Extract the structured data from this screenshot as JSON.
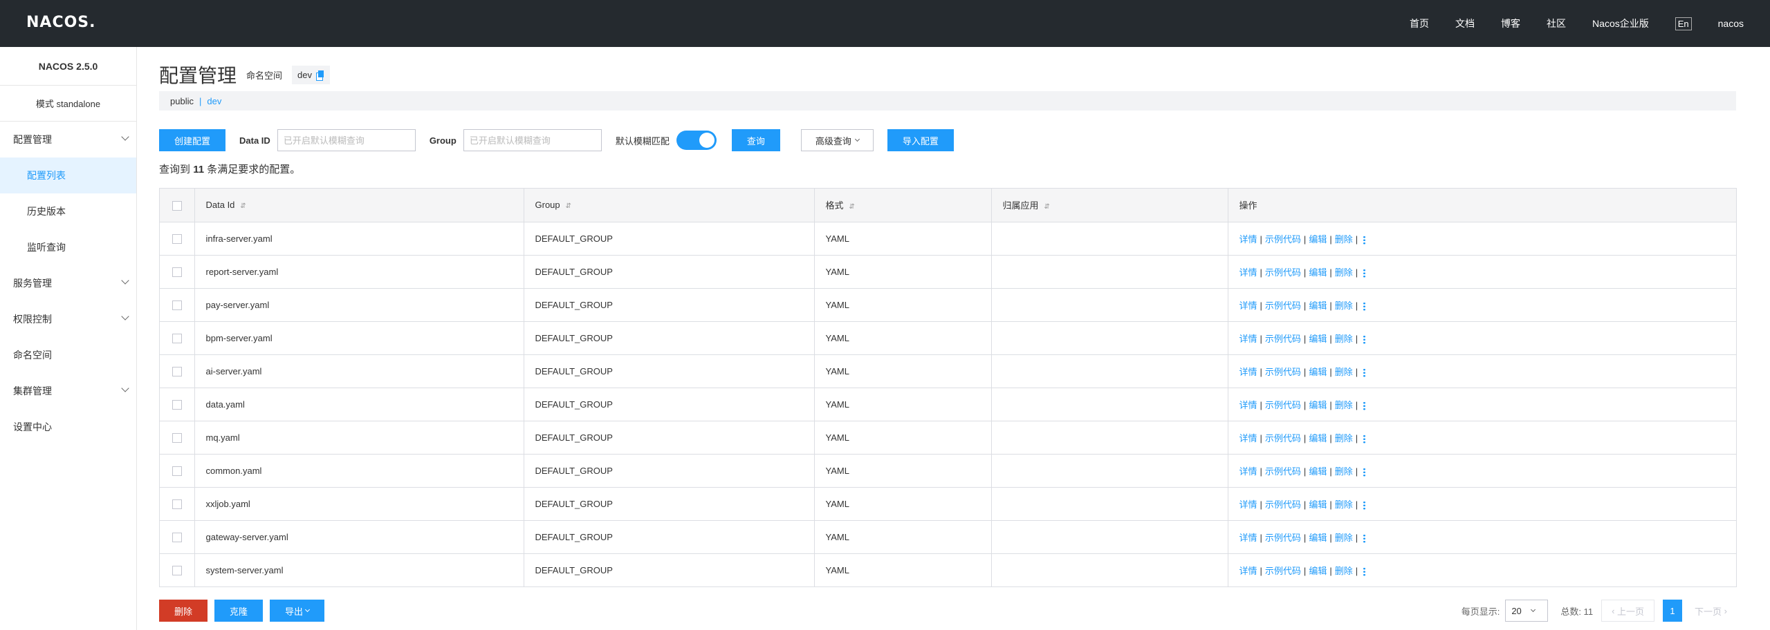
{
  "topbar": {
    "logo": "NACOS.",
    "nav": [
      "首页",
      "文档",
      "博客",
      "社区",
      "Nacos企业版"
    ],
    "lang": "En",
    "user": "nacos"
  },
  "sidebar": {
    "version": "NACOS 2.5.0",
    "mode": "模式 standalone",
    "items": [
      {
        "label": "配置管理",
        "expandable": true
      },
      {
        "label": "配置列表",
        "sub": true,
        "active": true
      },
      {
        "label": "历史版本",
        "sub": true
      },
      {
        "label": "监听查询",
        "sub": true
      },
      {
        "label": "服务管理",
        "expandable": true
      },
      {
        "label": "权限控制",
        "expandable": true
      },
      {
        "label": "命名空间"
      },
      {
        "label": "集群管理",
        "expandable": true
      },
      {
        "label": "设置中心"
      }
    ]
  },
  "header": {
    "title": "配置管理",
    "ns_label": "命名空间",
    "ns_value": "dev"
  },
  "ns_bar": {
    "public": "public",
    "sep": "|",
    "dev": "dev"
  },
  "toolbar": {
    "create": "创建配置",
    "dataid_label": "Data ID",
    "dataid_placeholder": "已开启默认模糊查询",
    "group_label": "Group",
    "group_placeholder": "已开启默认模糊查询",
    "fuzzy_label": "默认模糊匹配",
    "fuzzy_on": true,
    "query": "查询",
    "advanced": "高级查询",
    "import": "导入配置"
  },
  "result": {
    "prefix": "查询到",
    "count": "11",
    "suffix": "条满足要求的配置。"
  },
  "table": {
    "columns": [
      "Data Id",
      "Group",
      "格式",
      "归属应用",
      "操作"
    ],
    "rows": [
      {
        "data_id": "infra-server.yaml",
        "group": "DEFAULT_GROUP",
        "format": "YAML",
        "app": ""
      },
      {
        "data_id": "report-server.yaml",
        "group": "DEFAULT_GROUP",
        "format": "YAML",
        "app": ""
      },
      {
        "data_id": "pay-server.yaml",
        "group": "DEFAULT_GROUP",
        "format": "YAML",
        "app": ""
      },
      {
        "data_id": "bpm-server.yaml",
        "group": "DEFAULT_GROUP",
        "format": "YAML",
        "app": ""
      },
      {
        "data_id": "ai-server.yaml",
        "group": "DEFAULT_GROUP",
        "format": "YAML",
        "app": ""
      },
      {
        "data_id": "data.yaml",
        "group": "DEFAULT_GROUP",
        "format": "YAML",
        "app": ""
      },
      {
        "data_id": "mq.yaml",
        "group": "DEFAULT_GROUP",
        "format": "YAML",
        "app": ""
      },
      {
        "data_id": "common.yaml",
        "group": "DEFAULT_GROUP",
        "format": "YAML",
        "app": ""
      },
      {
        "data_id": "xxljob.yaml",
        "group": "DEFAULT_GROUP",
        "format": "YAML",
        "app": ""
      },
      {
        "data_id": "gateway-server.yaml",
        "group": "DEFAULT_GROUP",
        "format": "YAML",
        "app": ""
      },
      {
        "data_id": "system-server.yaml",
        "group": "DEFAULT_GROUP",
        "format": "YAML",
        "app": ""
      }
    ],
    "ops": [
      "详情",
      "示例代码",
      "编辑",
      "删除"
    ]
  },
  "footer": {
    "delete": "删除",
    "clone": "克隆",
    "export": "导出",
    "page_size_label": "每页显示:",
    "page_size": "20",
    "total_label": "总数: 11",
    "prev": "上一页",
    "page": "1",
    "next": "下一页"
  },
  "colors": {
    "topbar": "#252a2f",
    "accent": "#209bfa",
    "danger": "#d23c26"
  }
}
